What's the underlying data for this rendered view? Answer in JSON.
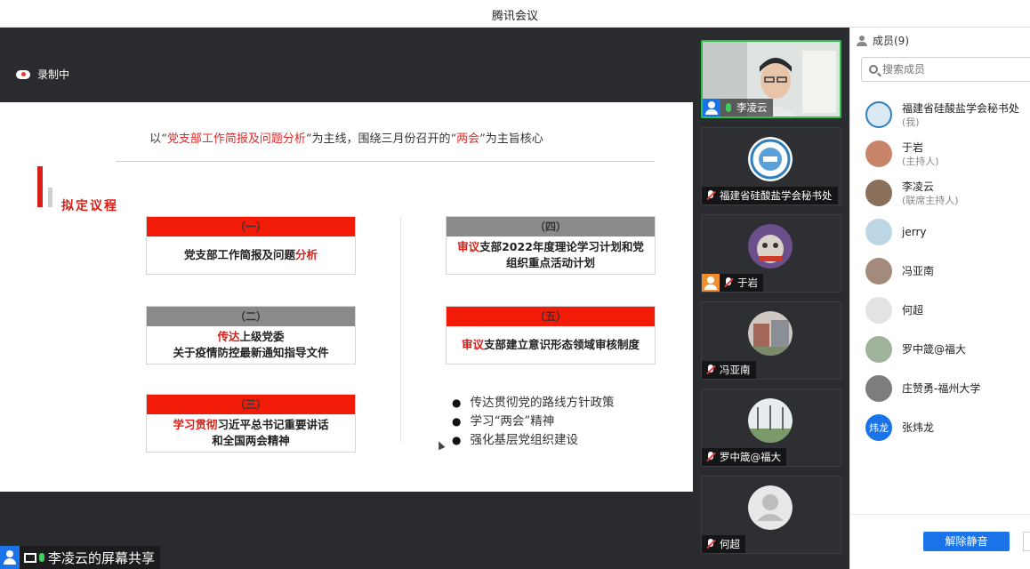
{
  "window": {
    "title": "腾讯会议"
  },
  "recording": {
    "label": "录制中"
  },
  "slide": {
    "heading_pre": "以“",
    "heading_hl1": "党支部工作简报及问题分析",
    "heading_mid": "”为主线，围绕三月份召开的“",
    "heading_hl2": "两会",
    "heading_post": "”为主旨核心",
    "agenda_title": "拟定议程",
    "cards": [
      {
        "num": "（一）",
        "line1_plain": "党支部工作简报及问题",
        "line1_red": "分析"
      },
      {
        "num": "（二）",
        "line1_red": "传达",
        "line1_plain": "上级党委",
        "line2": "关于疫情防控最新通知指导文件"
      },
      {
        "num": "（三）",
        "line1_red": "学习贯彻",
        "line1_plain": "习近平总书记重要讲话",
        "line2": "和全国两会精神"
      },
      {
        "num": "（四）",
        "line1_red": "审议",
        "line1_plain": "支部2022年度理论学习计划和党",
        "line2": "组织重点活动计划"
      },
      {
        "num": "（五）",
        "line1_red": "审议",
        "line1_plain": "支部建立意识形态领域审核制度"
      }
    ],
    "bullets": [
      "传达贯彻党的路线方针政策",
      "学习“两会”精神",
      "强化基层党组织建设"
    ]
  },
  "share_badge": {
    "label": "李凌云的屏幕共享"
  },
  "video_tiles": [
    {
      "name": "李凌云",
      "mic": "on",
      "badge": "blue"
    },
    {
      "name": "福建省硅酸盐学会秘书处",
      "mic": "off"
    },
    {
      "name": "于岩",
      "mic": "off",
      "badge": "orange"
    },
    {
      "name": "冯亚南",
      "mic": "off"
    },
    {
      "name": "罗中箴@福大",
      "mic": "off"
    },
    {
      "name": "何超",
      "mic": "off"
    }
  ],
  "members": {
    "header": "成员(9)",
    "search_placeholder": "搜索成员",
    "list": [
      {
        "name": "福建省硅酸盐学会秘书处",
        "role": "(我)",
        "avatar_color": "#dbe9f5"
      },
      {
        "name": "于岩",
        "role": "(主持人)",
        "avatar_color": "#c9856a"
      },
      {
        "name": "李凌云",
        "role": "(联席主持人)",
        "avatar_color": "#8a6f5a"
      },
      {
        "name": "jerry",
        "role": "",
        "avatar_color": "#bcd6e6"
      },
      {
        "name": "冯亚南",
        "role": "",
        "avatar_color": "#a38a7a"
      },
      {
        "name": "何超",
        "role": "",
        "avatar_color": "#e3e3e3"
      },
      {
        "name": "罗中箴@福大",
        "role": "",
        "avatar_color": "#9fb39a"
      },
      {
        "name": "庄赞勇-福州大学",
        "role": "",
        "avatar_color": "#7d7d7d"
      },
      {
        "name": "张炜龙",
        "role": "",
        "avatar_color": "#1a73e8",
        "avatar_text": "炜龙"
      }
    ],
    "unmute_label": "解除静音"
  }
}
